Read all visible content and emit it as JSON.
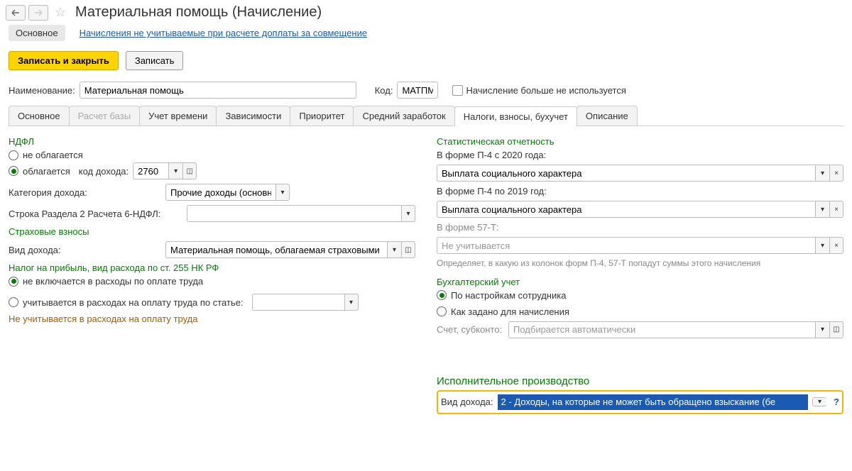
{
  "header": {
    "title": "Материальная помощь (Начисление)"
  },
  "mainTabs": {
    "basic": "Основное",
    "link": "Начисления не учитываемые при расчете доплаты за совмещение"
  },
  "actions": {
    "saveClose": "Записать и закрыть",
    "save": "Записать"
  },
  "form": {
    "nameLabel": "Наименование:",
    "nameValue": "Материальная помощь",
    "codeLabel": "Код:",
    "codeValue": "МАТПМ",
    "notUsedLabel": "Начисление больше не используется"
  },
  "tabs": {
    "t1": "Основное",
    "t2": "Расчет базы",
    "t3": "Учет времени",
    "t4": "Зависимости",
    "t5": "Приоритет",
    "t6": "Средний заработок",
    "t7": "Налоги, взносы, бухучет",
    "t8": "Описание"
  },
  "ndfl": {
    "title": "НДФЛ",
    "notTaxed": "не облагается",
    "taxed": "облагается",
    "codeLabel": "код дохода:",
    "codeValue": "2760",
    "categoryLabel": "Категория дохода:",
    "categoryValue": "Прочие доходы (основная",
    "section2Label": "Строка Раздела 2 Расчета 6-НДФЛ:",
    "section2Value": ""
  },
  "insurance": {
    "title": "Страховые взносы",
    "typeLabel": "Вид дохода:",
    "typeValue": "Материальная помощь, облагаемая страховыми взносами"
  },
  "profit": {
    "title": "Налог на прибыль, вид расхода по ст. 255 НК РФ",
    "notIncluded": "не включается в расходы по оплате труда",
    "includedArticle": "учитывается в расходах на оплату труда по статье:",
    "infoText": "Не учитывается в расходах на оплату труда"
  },
  "stats": {
    "title": "Статистическая отчетность",
    "p4from2020Label": "В форме П-4 с 2020 года:",
    "p4from2020Value": "Выплата социального характера",
    "p4to2019Label": "В форме П-4 по 2019 год:",
    "p4to2019Value": "Выплата социального характера",
    "f57tLabel": "В форме 57-Т:",
    "f57tValue": "Не учитывается",
    "hint": "Определяет, в какую из колонок форм П-4, 57-Т попадут суммы этого начисления"
  },
  "accounting": {
    "title": "Бухгалтерский учет",
    "byEmployee": "По настройкам сотрудника",
    "asSet": "Как задано для начисления",
    "accountLabel": "Счет, субконто:",
    "accountValue": "Подбирается автоматически"
  },
  "enforcement": {
    "title": "Исполнительное производство",
    "typeLabel": "Вид дохода:",
    "typeValue": "2 - Доходы, на которые не может быть обращено взыскание (бе"
  }
}
